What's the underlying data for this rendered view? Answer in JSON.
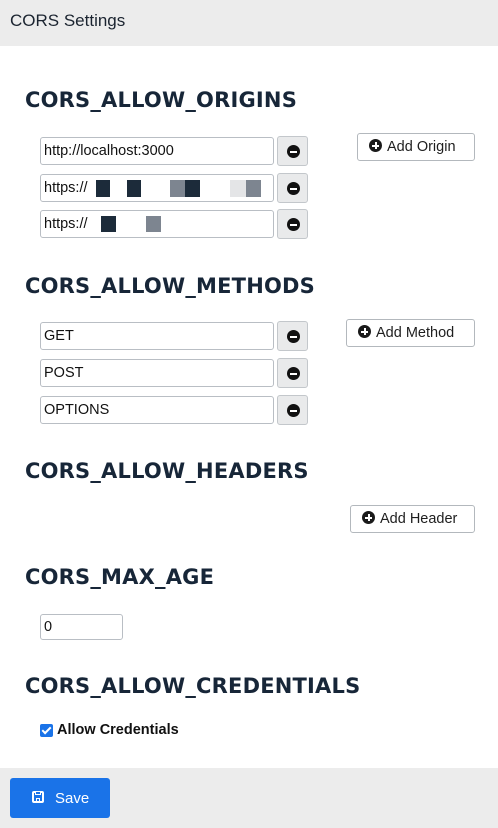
{
  "header": {
    "title": "CORS Settings"
  },
  "origins": {
    "title": "CORS_ALLOW_ORIGINS",
    "items": [
      "http://localhost:3000",
      "https://",
      "https://"
    ],
    "add_label": "Add Origin"
  },
  "methods": {
    "title": "CORS_ALLOW_METHODS",
    "items": [
      "GET",
      "POST",
      "OPTIONS"
    ],
    "add_label": "Add Method"
  },
  "headers": {
    "title": "CORS_ALLOW_HEADERS",
    "add_label": "Add Header"
  },
  "max_age": {
    "title": "CORS_MAX_AGE",
    "value": "0"
  },
  "credentials": {
    "title": "CORS_ALLOW_CREDENTIALS",
    "label": "Allow Credentials",
    "checked": true
  },
  "footer": {
    "save_label": "Save"
  },
  "colors": {
    "accent": "#1a73e8",
    "header_bg": "#ececec",
    "redaction_dark": "#1c2b3a",
    "redaction_gray": "#7d8590"
  }
}
